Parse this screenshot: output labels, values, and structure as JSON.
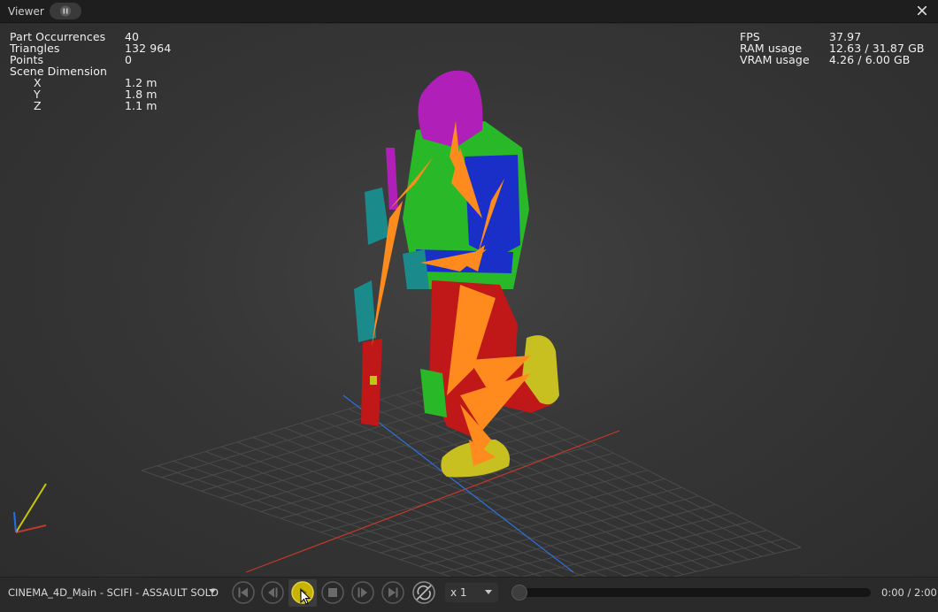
{
  "window": {
    "title": "Viewer",
    "pause_icon": "pause-icon",
    "close_icon": "close-icon"
  },
  "stats_left": [
    {
      "label": "Part Occurrences",
      "value": "40"
    },
    {
      "label": "Triangles",
      "value": "132 964"
    },
    {
      "label": "Points",
      "value": "0"
    },
    {
      "label": "Scene Dimension",
      "value": ""
    },
    {
      "label": "X",
      "value": "1.2 m"
    },
    {
      "label": "Y",
      "value": "1.8 m"
    },
    {
      "label": "Z",
      "value": "1.1 m"
    }
  ],
  "stats_right": [
    {
      "label": "FPS",
      "value": "37.97"
    },
    {
      "label": "RAM usage",
      "value": "12.63 / 31.87 GB"
    },
    {
      "label": "VRAM usage",
      "value": "4.26 / 6.00 GB"
    }
  ],
  "scene": {
    "grid_color": "#4a4a4a",
    "axis_x_color": "#c0392b",
    "axis_z_color": "#2e6fd8",
    "axis_y_color": "#c8c800",
    "part_colors": {
      "helmet": "#b020b8",
      "torso": "#28b828",
      "chest": "#1a2fc8",
      "legs": "#c01818",
      "boots": "#c8c020",
      "bones": "#ff8a1e",
      "weapon": "#1a8a8a"
    }
  },
  "playback": {
    "animation_name": "CINEMA_4D_Main - SCIFI - ASSAULT SOLD",
    "speed": "x 1",
    "time": "0:00 / 2:00",
    "progress": 0.0,
    "accent_color": "#c8b400"
  }
}
